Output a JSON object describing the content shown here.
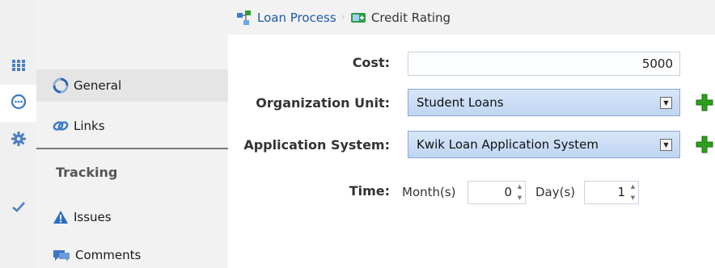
{
  "rail": {
    "items": [
      {
        "icon": "grid-icon"
      },
      {
        "icon": "chat-icon",
        "active": true
      },
      {
        "icon": "gear-icon"
      },
      {
        "icon": "checkmark-icon"
      }
    ]
  },
  "nav": {
    "items": [
      {
        "label": "General",
        "icon": "refresh-icon",
        "selected": true
      },
      {
        "label": "Links",
        "icon": "link-icon"
      }
    ],
    "tracking_heading": "Tracking",
    "tracking_items": [
      {
        "label": "Issues",
        "icon": "warning-icon"
      },
      {
        "label": "Comments",
        "icon": "comment-icon"
      }
    ]
  },
  "breadcrumb": {
    "parent": "Loan Process",
    "current": "Credit Rating"
  },
  "form": {
    "cost_label": "Cost:",
    "cost_value": "5000",
    "org_unit_label": "Organization Unit:",
    "org_unit_value": "Student Loans",
    "app_system_label": "Application System:",
    "app_system_value": "Kwik Loan Application System",
    "time_label": "Time:",
    "months_label": "Month(s)",
    "months_value": "0",
    "days_label": "Day(s)",
    "days_value": "1"
  },
  "colors": {
    "accent_link": "#1d5aa8",
    "add_icon": "#2e9e1f",
    "select_bg": "#c9dcf5"
  }
}
